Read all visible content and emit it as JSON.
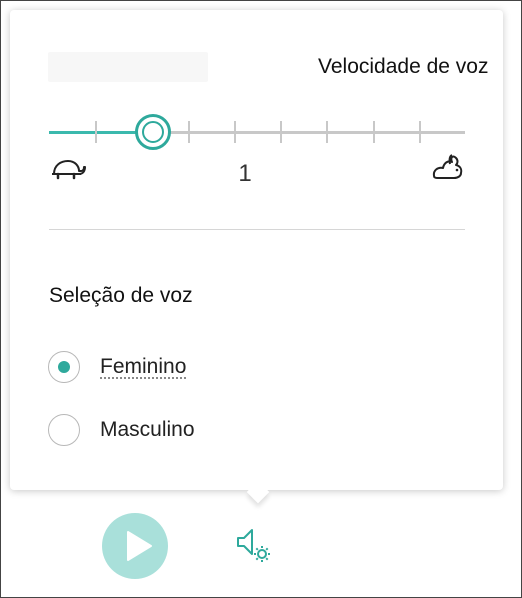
{
  "speed": {
    "title": "Velocidade de voz",
    "value": 1,
    "value_label": "1",
    "fraction": 0.25,
    "slow_icon": "turtle-icon",
    "fast_icon": "rabbit-icon"
  },
  "voice": {
    "title": "Seleção de voz",
    "options": [
      {
        "label": "Feminino",
        "selected": true
      },
      {
        "label": "Masculino",
        "selected": false
      }
    ]
  },
  "controls": {
    "play_icon": "play-icon",
    "settings_icon": "speaker-settings-icon"
  },
  "colors": {
    "accent": "#2ea99c",
    "play_button": "#a9e0da",
    "track": "#c8c8c8"
  }
}
